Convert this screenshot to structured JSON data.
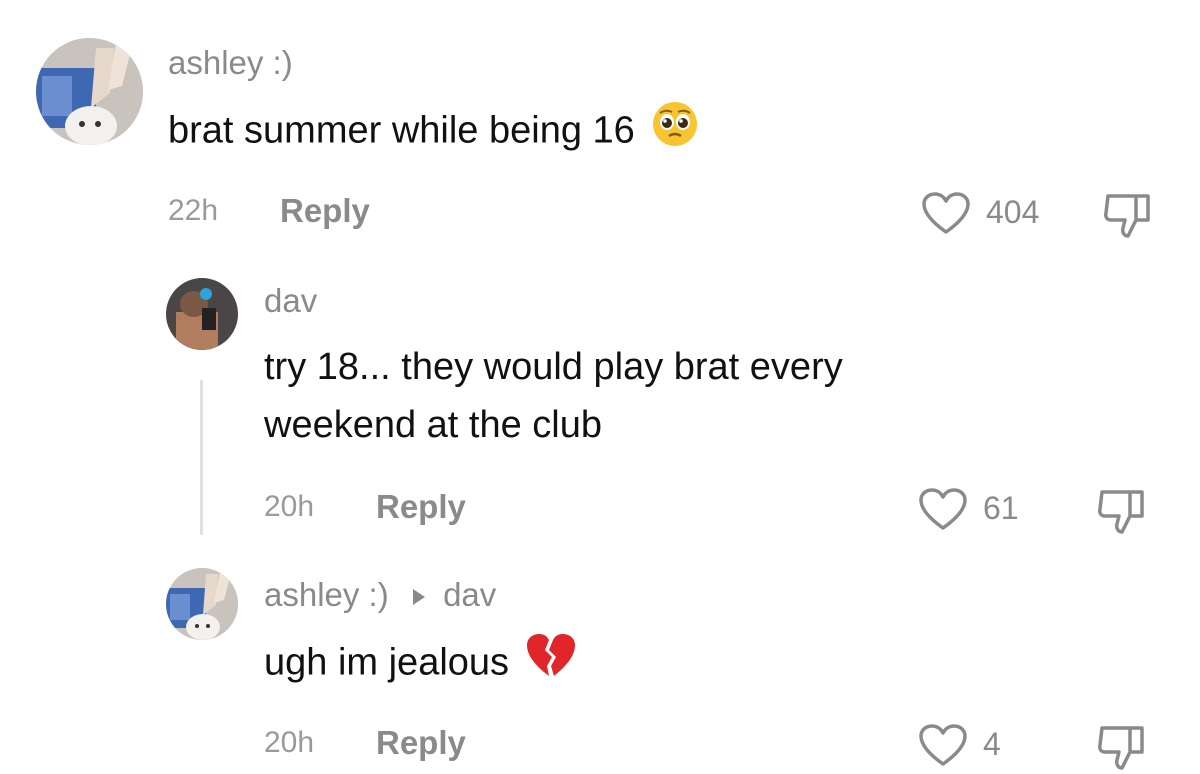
{
  "comments": [
    {
      "username": "ashley :)",
      "text": "brat summer while being 16",
      "emoji_icon": "pleading-face-icon",
      "time": "22h",
      "reply_label": "Reply",
      "like_count": "404"
    },
    {
      "username": "dav",
      "text_line1": "try 18... they would play brat every",
      "text_line2": "weekend at the club",
      "time": "20h",
      "reply_label": "Reply",
      "like_count": "61"
    },
    {
      "username": "ashley :)",
      "reply_to": "dav",
      "text": "ugh im jealous",
      "emoji_icon": "broken-heart-icon",
      "time": "20h",
      "reply_label": "Reply",
      "like_count": "4"
    }
  ],
  "colors": {
    "meta_gray": "#8a8a8a",
    "text": "#111111",
    "broken_heart": "#e0262b",
    "emoji_yellow": "#f7c531"
  }
}
